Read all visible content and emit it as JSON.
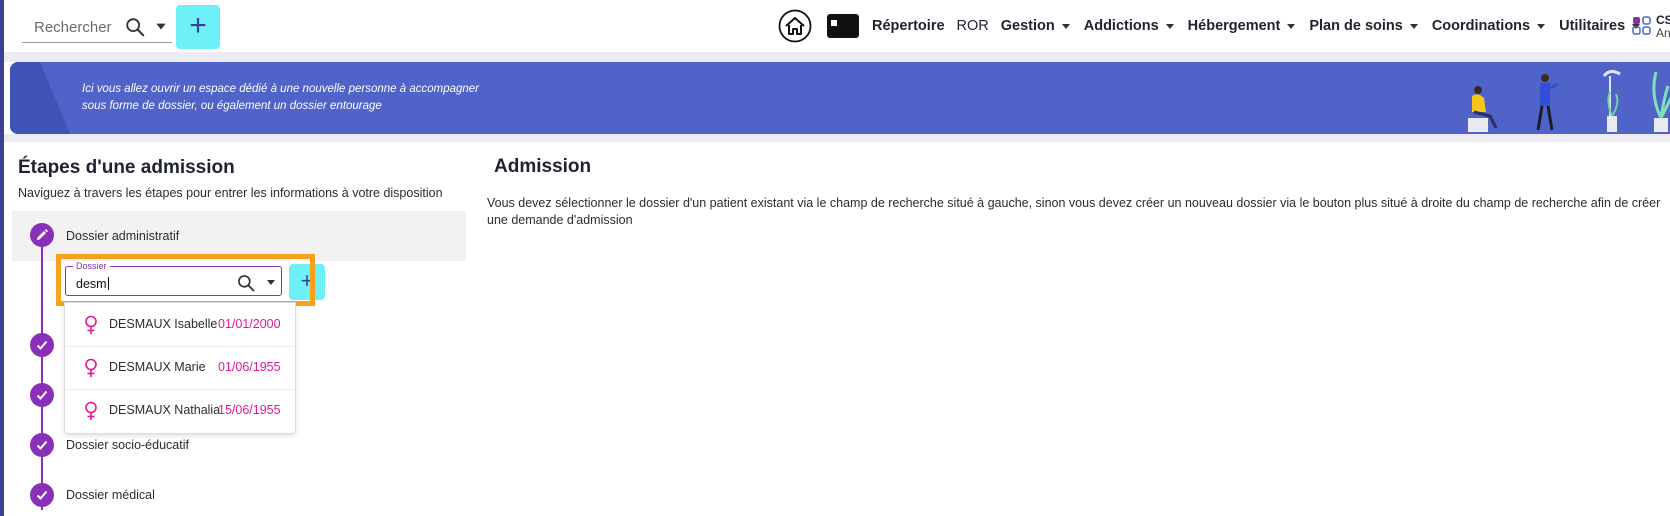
{
  "topbar": {
    "search_placeholder": "Rechercher",
    "nav": [
      {
        "label": "Répertoire",
        "dropdown": false,
        "bold": true
      },
      {
        "label": "ROR",
        "dropdown": false,
        "bold": false
      },
      {
        "label": "Gestion",
        "dropdown": true,
        "bold": true
      },
      {
        "label": "Addictions",
        "dropdown": true,
        "bold": true
      },
      {
        "label": "Hébergement",
        "dropdown": true,
        "bold": true
      },
      {
        "label": "Plan de soins",
        "dropdown": true,
        "bold": true
      },
      {
        "label": "Coordinations",
        "dropdown": true,
        "bold": true
      },
      {
        "label": "Utilitaires",
        "dropdown": true,
        "bold": true
      }
    ],
    "user_line1": "CS",
    "user_line2": "An"
  },
  "banner": {
    "text": "Ici vous allez ouvrir un espace dédié à une nouvelle personne à accompagner sous forme de dossier, ou également un dossier entourage"
  },
  "steps": {
    "title": "Étapes d'une admission",
    "subtitle": "Naviguez à travers les étapes pour entrer les informations à votre disposition",
    "items": [
      {
        "label": "Dossier administratif",
        "state": "active"
      },
      {
        "label": "",
        "state": "done"
      },
      {
        "label": "",
        "state": "done"
      },
      {
        "label": "Dossier socio-éducatif",
        "state": "done"
      },
      {
        "label": "Dossier médical",
        "state": "done"
      }
    ]
  },
  "dossier": {
    "legend": "Dossier",
    "value": "desm",
    "results": [
      {
        "name": "DESMAUX Isabelle",
        "date": "01/01/2000",
        "gender_icon": "female-icon"
      },
      {
        "name": "DESMAUX Marie",
        "date": "01/06/1955",
        "gender_icon": "female-icon"
      },
      {
        "name": "DESMAUX Nathalia",
        "date": "15/06/1955",
        "gender_icon": "female-icon"
      }
    ]
  },
  "main": {
    "title": "Admission",
    "text": "Vous devez sélectionner le dossier d'un patient existant via le champ de recherche situé à gauche, sinon vous devez créer un nouveau dossier via le bouton plus situé à droite du champ de recherche afin de créer une demande d'admission"
  },
  "colors": {
    "primary": "#8a2fb8",
    "accent_cyan": "#6df0f7",
    "banner": "#4f63c9",
    "highlight": "#f6a21f",
    "date_pink": "#e0189b"
  }
}
